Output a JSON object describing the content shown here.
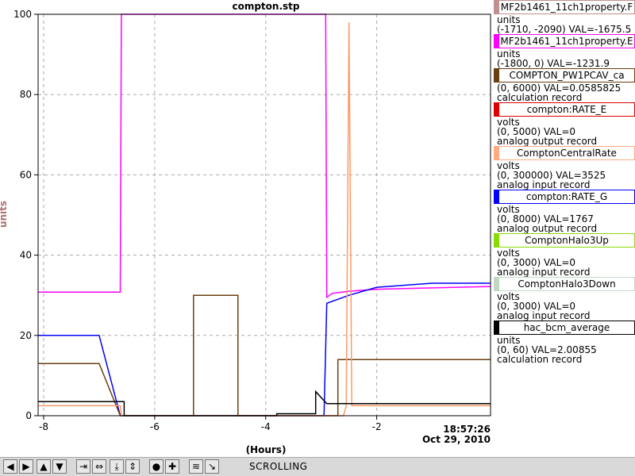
{
  "chart_data": {
    "type": "line",
    "title": "compton.stp",
    "xlabel": "(Hours)",
    "ylabel": "units",
    "xlim": [
      -8.1,
      0.05
    ],
    "ylim": [
      0,
      100
    ],
    "x_ticks": [
      -8,
      -6,
      -4,
      -2
    ],
    "y_ticks": [
      0,
      20,
      40,
      60,
      80,
      100
    ],
    "x_tick_labels": [
      "-8",
      "-6",
      "-4",
      "-2"
    ],
    "y_tick_labels": [
      "0",
      "20",
      "40",
      "60",
      "80",
      "100"
    ],
    "timestamp_time": "18:57:26",
    "timestamp_date": "Oct 29, 2010",
    "grid": true,
    "series": [
      {
        "color": "#ff00ff",
        "x": [
          -8.1,
          -6.62,
          -6.6,
          -2.92,
          -2.9,
          -2.8,
          -2.5,
          -2.0,
          0.05
        ],
        "y": [
          30.8,
          30.8,
          100,
          100,
          29.5,
          30.5,
          31,
          31.5,
          32.2
        ]
      },
      {
        "color": "#0000ff",
        "x": [
          -8.1,
          -7.0,
          -6.62,
          -6.6,
          -2.95,
          -2.9,
          -2.5,
          -2.0,
          -1.0,
          0.05
        ],
        "y": [
          20,
          20,
          0,
          0,
          0,
          28,
          30,
          32,
          33,
          33
        ]
      },
      {
        "color": "#6b4010",
        "x": [
          -8.1,
          -7.0,
          -6.62,
          -5.3,
          -5.3,
          -4.5,
          -4.5,
          -2.7,
          -2.7,
          -1.0,
          0.05
        ],
        "y": [
          13,
          13,
          0,
          0,
          30,
          30,
          0,
          0,
          14,
          14,
          14
        ]
      },
      {
        "color": "#ff9966",
        "x": [
          -8.1,
          -6.62,
          -6.6,
          -2.6,
          -2.55,
          -2.5,
          -2.45,
          -2.4,
          0.05
        ],
        "y": [
          2.5,
          2.5,
          0,
          0,
          2.5,
          98,
          2.5,
          2.5,
          2.5
        ]
      },
      {
        "color": "#000000",
        "x": [
          -8.1,
          -7.6,
          -7.6,
          -6.55,
          -6.55,
          -3.8,
          -3.8,
          -3.1,
          -3.1,
          -2.9,
          0.05
        ],
        "y": [
          3.5,
          3.5,
          3.5,
          3.5,
          0,
          0,
          0.5,
          0.5,
          6,
          3,
          3
        ]
      }
    ]
  },
  "legend": [
    {
      "name": "MF2b1461_11ch1property.F",
      "color": "#c09090",
      "lines": [
        "units",
        "(-1710, -2090) VAL=-1675.5"
      ]
    },
    {
      "name": "MF2b1461_11ch1property.E",
      "color": "#ff00ff",
      "lines": [
        "units",
        "(-1800, 0) VAL=-1231.9"
      ]
    },
    {
      "name": "COMPTON_PW1PCAV_ca",
      "color": "#6b4010",
      "lines": [
        "(0, 6000) VAL=0.0585825",
        "calculation record"
      ]
    },
    {
      "name": "compton:RATE_E",
      "color": "#e00000",
      "lines": [
        "volts",
        "(0, 5000) VAL=0",
        "analog output record"
      ]
    },
    {
      "name": "ComptonCentralRate",
      "color": "#ffaa80",
      "lines": [
        "volts",
        "(0, 300000) VAL=3525",
        "analog input record"
      ]
    },
    {
      "name": "compton:RATE_G",
      "color": "#0000ff",
      "lines": [
        "volts",
        "(0, 8000) VAL=1767",
        "analog output record"
      ]
    },
    {
      "name": "ComptonHalo3Up",
      "color": "#88dd00",
      "lines": [
        "volts",
        "(0, 3000) VAL=0",
        "analog input record"
      ]
    },
    {
      "name": "ComptonHalo3Down",
      "color": "#c0d8c0",
      "lines": [
        "volts",
        "(0, 3000) VAL=0",
        "analog input record"
      ]
    },
    {
      "name": "hac_bcm_average",
      "color": "#000000",
      "lines": [
        "units",
        "(0, 60) VAL=2.00855",
        "calculation record"
      ]
    }
  ],
  "toolbar": {
    "status": "SCROLLING",
    "buttons": [
      {
        "icon": "arrow-left-icon",
        "glyph": "◀"
      },
      {
        "icon": "arrow-right-icon",
        "glyph": "▶"
      },
      {
        "icon": "arrow-up-icon",
        "glyph": "▲"
      },
      {
        "icon": "arrow-down-icon",
        "glyph": "▼"
      },
      {
        "icon": "zoom-in-horizontal-icon",
        "glyph": "⇥"
      },
      {
        "icon": "zoom-out-horizontal-icon",
        "glyph": "⇔"
      },
      {
        "icon": "zoom-in-vertical-icon",
        "glyph": "⤓"
      },
      {
        "icon": "zoom-out-vertical-icon",
        "glyph": "⇕"
      },
      {
        "icon": "circle-icon",
        "glyph": "●"
      },
      {
        "icon": "plus-icon",
        "glyph": "✚"
      },
      {
        "icon": "auto-scale-icon",
        "glyph": "≋"
      },
      {
        "icon": "scroll-icon",
        "glyph": "↘"
      }
    ]
  }
}
